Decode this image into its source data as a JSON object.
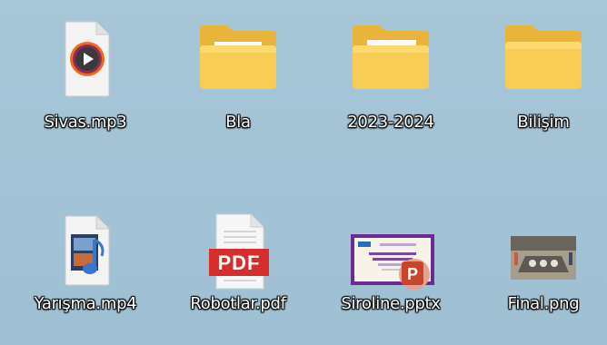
{
  "desktop": {
    "items": [
      {
        "label": "Sivas.mp3",
        "icon": "audio-file-icon"
      },
      {
        "label": "Bla",
        "icon": "folder-icon"
      },
      {
        "label": "2023-2024",
        "icon": "folder-icon"
      },
      {
        "label": "Bilişim",
        "icon": "folder-icon"
      },
      {
        "label": "Yarışma.mp4",
        "icon": "video-file-icon"
      },
      {
        "label": "Robotlar.pdf",
        "icon": "pdf-file-icon",
        "badge": "PDF"
      },
      {
        "label": "Siroline.pptx",
        "icon": "powerpoint-file-icon",
        "badge": "P"
      },
      {
        "label": "Final.png",
        "icon": "image-file-icon"
      }
    ]
  },
  "colors": {
    "background": "#a5c4d6",
    "folder": "#f7c94c",
    "pdf_red": "#d62d2d",
    "ppt_orange": "#c8442b",
    "ppt_thumb_frame": "#6b2c91"
  }
}
